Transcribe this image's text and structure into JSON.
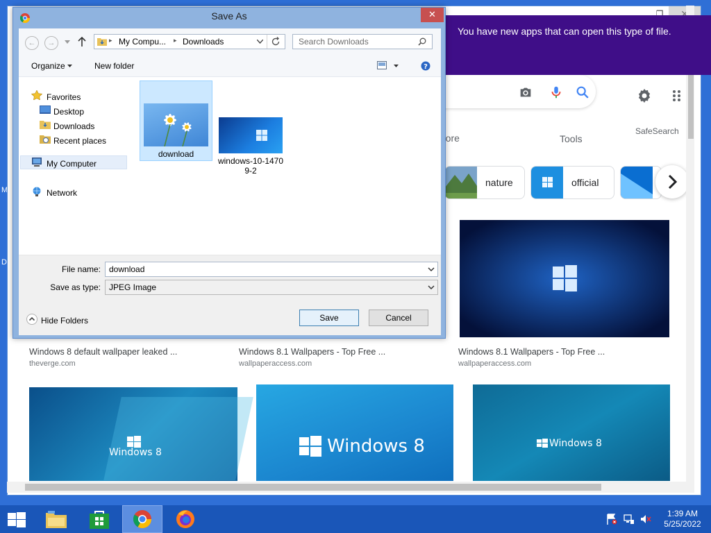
{
  "desktop": {
    "edge_letters": [
      "M",
      "D"
    ]
  },
  "browser": {
    "tabs_row": {
      "more_label": "More",
      "tools_label": "Tools",
      "safesearch_label": "SafeSearch"
    },
    "chips": [
      {
        "label": "nature"
      },
      {
        "label": "official"
      }
    ],
    "results_row1": [
      {
        "title": "Windows 8 default wallpaper leaked ...",
        "site": "theverge.com"
      },
      {
        "title": "Windows 8.1 Wallpapers - Top Free ...",
        "site": "wallpaperaccess.com"
      },
      {
        "title": "Windows 8.1 Wallpapers - Top Free ...",
        "site": "wallpaperaccess.com"
      }
    ],
    "results_row2": [
      {
        "img_text": "Windows 8"
      },
      {
        "img_text": "Windows 8"
      },
      {
        "img_text": "Windows 8"
      }
    ]
  },
  "notification": {
    "text": "You have new apps that can open this type of file."
  },
  "dialog": {
    "title": "Save As",
    "close_glyph": "✕",
    "address": {
      "crumb1": "My Compu...",
      "crumb2": "Downloads"
    },
    "search": {
      "placeholder": "Search Downloads"
    },
    "toolbar": {
      "organize": "Organize",
      "new_folder": "New folder"
    },
    "nav": {
      "favorites": "Favorites",
      "desktop": "Desktop",
      "downloads": "Downloads",
      "recent": "Recent places",
      "my_computer": "My Computer",
      "network": "Network"
    },
    "files": [
      {
        "name": "download",
        "selected": true
      },
      {
        "name_line1": "windows-10-1470",
        "name_line2": "9-2"
      }
    ],
    "file_name_label": "File name:",
    "file_name_value": "download",
    "save_type_label": "Save as type:",
    "save_type_value": "JPEG Image",
    "hide_folders": "Hide Folders",
    "save_button": "Save",
    "cancel_button": "Cancel"
  },
  "taskbar": {
    "time": "1:39 AM",
    "date": "5/25/2022"
  },
  "colors": {
    "taskbar": "#1a56b8",
    "toast": "#3f0e88",
    "dialog_frame": "#8fb3df",
    "close_red": "#c75050"
  }
}
